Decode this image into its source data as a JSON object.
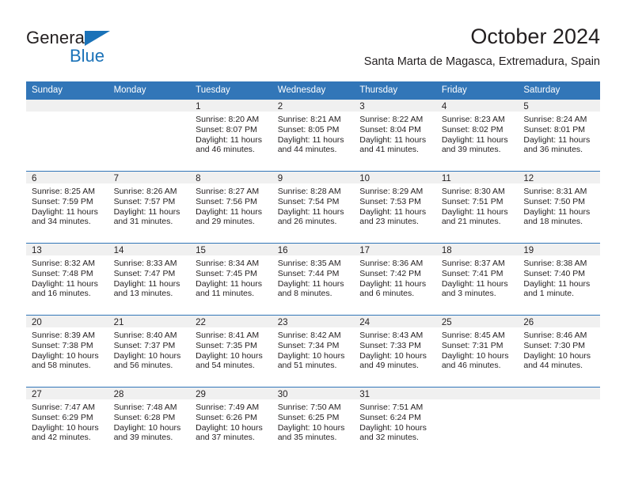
{
  "brand": {
    "name_primary": "General",
    "name_secondary": "Blue",
    "triangle_icon": "triangle-icon"
  },
  "header": {
    "title": "October 2024",
    "subtitle": "Santa Marta de Magasca, Extremadura, Spain"
  },
  "colors": {
    "header_blue": "#3276b8",
    "brand_blue": "#1a72b8",
    "date_band_gray": "#f0f0f0",
    "text": "#231f20"
  },
  "weekday_headers": [
    "Sunday",
    "Monday",
    "Tuesday",
    "Wednesday",
    "Thursday",
    "Friday",
    "Saturday"
  ],
  "labels": {
    "sunrise_prefix": "Sunrise:",
    "sunset_prefix": "Sunset:",
    "daylight_prefix": "Daylight:"
  },
  "weeks": [
    [
      {
        "date": "",
        "empty": true
      },
      {
        "date": "",
        "empty": true
      },
      {
        "date": "1",
        "sunrise": "Sunrise: 8:20 AM",
        "sunset": "Sunset: 8:07 PM",
        "daylight_line1": "Daylight: 11 hours",
        "daylight_line2": "and 46 minutes."
      },
      {
        "date": "2",
        "sunrise": "Sunrise: 8:21 AM",
        "sunset": "Sunset: 8:05 PM",
        "daylight_line1": "Daylight: 11 hours",
        "daylight_line2": "and 44 minutes."
      },
      {
        "date": "3",
        "sunrise": "Sunrise: 8:22 AM",
        "sunset": "Sunset: 8:04 PM",
        "daylight_line1": "Daylight: 11 hours",
        "daylight_line2": "and 41 minutes."
      },
      {
        "date": "4",
        "sunrise": "Sunrise: 8:23 AM",
        "sunset": "Sunset: 8:02 PM",
        "daylight_line1": "Daylight: 11 hours",
        "daylight_line2": "and 39 minutes."
      },
      {
        "date": "5",
        "sunrise": "Sunrise: 8:24 AM",
        "sunset": "Sunset: 8:01 PM",
        "daylight_line1": "Daylight: 11 hours",
        "daylight_line2": "and 36 minutes."
      }
    ],
    [
      {
        "date": "6",
        "sunrise": "Sunrise: 8:25 AM",
        "sunset": "Sunset: 7:59 PM",
        "daylight_line1": "Daylight: 11 hours",
        "daylight_line2": "and 34 minutes."
      },
      {
        "date": "7",
        "sunrise": "Sunrise: 8:26 AM",
        "sunset": "Sunset: 7:57 PM",
        "daylight_line1": "Daylight: 11 hours",
        "daylight_line2": "and 31 minutes."
      },
      {
        "date": "8",
        "sunrise": "Sunrise: 8:27 AM",
        "sunset": "Sunset: 7:56 PM",
        "daylight_line1": "Daylight: 11 hours",
        "daylight_line2": "and 29 minutes."
      },
      {
        "date": "9",
        "sunrise": "Sunrise: 8:28 AM",
        "sunset": "Sunset: 7:54 PM",
        "daylight_line1": "Daylight: 11 hours",
        "daylight_line2": "and 26 minutes."
      },
      {
        "date": "10",
        "sunrise": "Sunrise: 8:29 AM",
        "sunset": "Sunset: 7:53 PM",
        "daylight_line1": "Daylight: 11 hours",
        "daylight_line2": "and 23 minutes."
      },
      {
        "date": "11",
        "sunrise": "Sunrise: 8:30 AM",
        "sunset": "Sunset: 7:51 PM",
        "daylight_line1": "Daylight: 11 hours",
        "daylight_line2": "and 21 minutes."
      },
      {
        "date": "12",
        "sunrise": "Sunrise: 8:31 AM",
        "sunset": "Sunset: 7:50 PM",
        "daylight_line1": "Daylight: 11 hours",
        "daylight_line2": "and 18 minutes."
      }
    ],
    [
      {
        "date": "13",
        "sunrise": "Sunrise: 8:32 AM",
        "sunset": "Sunset: 7:48 PM",
        "daylight_line1": "Daylight: 11 hours",
        "daylight_line2": "and 16 minutes."
      },
      {
        "date": "14",
        "sunrise": "Sunrise: 8:33 AM",
        "sunset": "Sunset: 7:47 PM",
        "daylight_line1": "Daylight: 11 hours",
        "daylight_line2": "and 13 minutes."
      },
      {
        "date": "15",
        "sunrise": "Sunrise: 8:34 AM",
        "sunset": "Sunset: 7:45 PM",
        "daylight_line1": "Daylight: 11 hours",
        "daylight_line2": "and 11 minutes."
      },
      {
        "date": "16",
        "sunrise": "Sunrise: 8:35 AM",
        "sunset": "Sunset: 7:44 PM",
        "daylight_line1": "Daylight: 11 hours",
        "daylight_line2": "and 8 minutes."
      },
      {
        "date": "17",
        "sunrise": "Sunrise: 8:36 AM",
        "sunset": "Sunset: 7:42 PM",
        "daylight_line1": "Daylight: 11 hours",
        "daylight_line2": "and 6 minutes."
      },
      {
        "date": "18",
        "sunrise": "Sunrise: 8:37 AM",
        "sunset": "Sunset: 7:41 PM",
        "daylight_line1": "Daylight: 11 hours",
        "daylight_line2": "and 3 minutes."
      },
      {
        "date": "19",
        "sunrise": "Sunrise: 8:38 AM",
        "sunset": "Sunset: 7:40 PM",
        "daylight_line1": "Daylight: 11 hours",
        "daylight_line2": "and 1 minute."
      }
    ],
    [
      {
        "date": "20",
        "sunrise": "Sunrise: 8:39 AM",
        "sunset": "Sunset: 7:38 PM",
        "daylight_line1": "Daylight: 10 hours",
        "daylight_line2": "and 58 minutes."
      },
      {
        "date": "21",
        "sunrise": "Sunrise: 8:40 AM",
        "sunset": "Sunset: 7:37 PM",
        "daylight_line1": "Daylight: 10 hours",
        "daylight_line2": "and 56 minutes."
      },
      {
        "date": "22",
        "sunrise": "Sunrise: 8:41 AM",
        "sunset": "Sunset: 7:35 PM",
        "daylight_line1": "Daylight: 10 hours",
        "daylight_line2": "and 54 minutes."
      },
      {
        "date": "23",
        "sunrise": "Sunrise: 8:42 AM",
        "sunset": "Sunset: 7:34 PM",
        "daylight_line1": "Daylight: 10 hours",
        "daylight_line2": "and 51 minutes."
      },
      {
        "date": "24",
        "sunrise": "Sunrise: 8:43 AM",
        "sunset": "Sunset: 7:33 PM",
        "daylight_line1": "Daylight: 10 hours",
        "daylight_line2": "and 49 minutes."
      },
      {
        "date": "25",
        "sunrise": "Sunrise: 8:45 AM",
        "sunset": "Sunset: 7:31 PM",
        "daylight_line1": "Daylight: 10 hours",
        "daylight_line2": "and 46 minutes."
      },
      {
        "date": "26",
        "sunrise": "Sunrise: 8:46 AM",
        "sunset": "Sunset: 7:30 PM",
        "daylight_line1": "Daylight: 10 hours",
        "daylight_line2": "and 44 minutes."
      }
    ],
    [
      {
        "date": "27",
        "sunrise": "Sunrise: 7:47 AM",
        "sunset": "Sunset: 6:29 PM",
        "daylight_line1": "Daylight: 10 hours",
        "daylight_line2": "and 42 minutes."
      },
      {
        "date": "28",
        "sunrise": "Sunrise: 7:48 AM",
        "sunset": "Sunset: 6:28 PM",
        "daylight_line1": "Daylight: 10 hours",
        "daylight_line2": "and 39 minutes."
      },
      {
        "date": "29",
        "sunrise": "Sunrise: 7:49 AM",
        "sunset": "Sunset: 6:26 PM",
        "daylight_line1": "Daylight: 10 hours",
        "daylight_line2": "and 37 minutes."
      },
      {
        "date": "30",
        "sunrise": "Sunrise: 7:50 AM",
        "sunset": "Sunset: 6:25 PM",
        "daylight_line1": "Daylight: 10 hours",
        "daylight_line2": "and 35 minutes."
      },
      {
        "date": "31",
        "sunrise": "Sunrise: 7:51 AM",
        "sunset": "Sunset: 6:24 PM",
        "daylight_line1": "Daylight: 10 hours",
        "daylight_line2": "and 32 minutes."
      },
      {
        "date": "",
        "empty": true
      },
      {
        "date": "",
        "empty": true
      }
    ]
  ]
}
